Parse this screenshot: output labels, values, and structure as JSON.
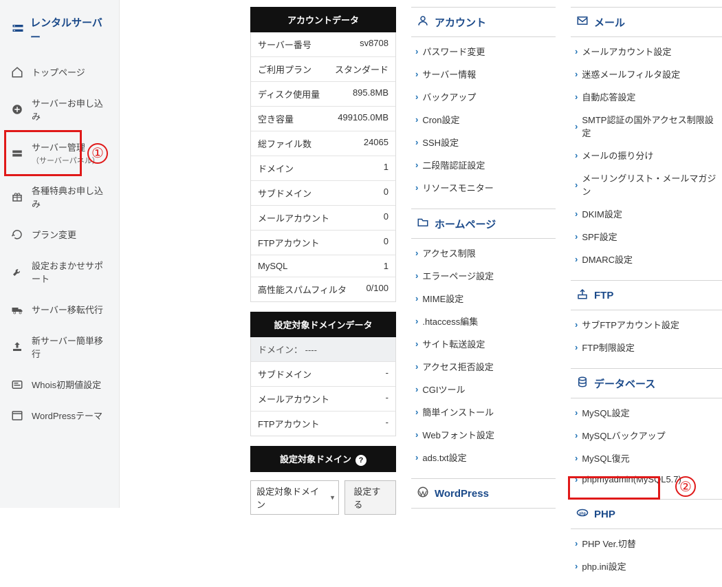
{
  "brand": "レンタルサーバー",
  "sidebar": [
    {
      "icon": "home",
      "label": "トップページ"
    },
    {
      "icon": "plus",
      "label": "サーバーお申し込み"
    },
    {
      "icon": "server",
      "label": "サーバー管理",
      "sub": "（サーバーパネル）",
      "highlight": true,
      "marker": "①"
    },
    {
      "icon": "gift",
      "label": "各種特典お申し込み"
    },
    {
      "icon": "refresh",
      "label": "プラン変更"
    },
    {
      "icon": "wrench",
      "label": "設定おまかせサポート"
    },
    {
      "icon": "truck",
      "label": "サーバー移転代行"
    },
    {
      "icon": "upload",
      "label": "新サーバー簡単移行"
    },
    {
      "icon": "card",
      "label": "Whois初期値設定"
    },
    {
      "icon": "window",
      "label": "WordPressテーマ"
    }
  ],
  "account_data": {
    "title": "アカウントデータ",
    "rows": [
      {
        "k": "サーバー番号",
        "v": "sv8708"
      },
      {
        "k": "ご利用プラン",
        "v": "スタンダード"
      },
      {
        "k": "ディスク使用量",
        "v": "895.8MB"
      },
      {
        "k": "空き容量",
        "v": "499105.0MB"
      },
      {
        "k": "総ファイル数",
        "v": "24065"
      },
      {
        "k": "ドメイン",
        "v": "1"
      },
      {
        "k": "サブドメイン",
        "v": "0"
      },
      {
        "k": "メールアカウント",
        "v": "0"
      },
      {
        "k": "FTPアカウント",
        "v": "0"
      },
      {
        "k": "MySQL",
        "v": "1"
      },
      {
        "k": "高性能スパムフィルタ",
        "v": "0/100"
      }
    ]
  },
  "domain_data": {
    "title": "設定対象ドメインデータ",
    "top": "ドメイン： ----",
    "rows": [
      {
        "k": "サブドメイン",
        "v": "-"
      },
      {
        "k": "メールアカウント",
        "v": "-"
      },
      {
        "k": "FTPアカウント",
        "v": "-"
      }
    ]
  },
  "domain_target": {
    "title": "設定対象ドメイン",
    "select": "設定対象ドメイン",
    "button": "設定する"
  },
  "cats_mid": [
    {
      "icon": "user",
      "title": "アカウント",
      "items": [
        "パスワード変更",
        "サーバー情報",
        "バックアップ",
        "Cron設定",
        "SSH設定",
        "二段階認証設定",
        "リソースモニター"
      ]
    },
    {
      "icon": "folder",
      "title": "ホームページ",
      "items": [
        "アクセス制限",
        "エラーページ設定",
        "MIME設定",
        ".htaccess編集",
        "サイト転送設定",
        "アクセス拒否設定",
        "CGIツール",
        "簡単インストール",
        "Webフォント設定",
        "ads.txt設定"
      ]
    },
    {
      "icon": "wp",
      "title": "WordPress",
      "items": []
    }
  ],
  "cats_right": [
    {
      "icon": "mail",
      "title": "メール",
      "items": [
        "メールアカウント設定",
        "迷惑メールフィルタ設定",
        "自動応答設定",
        "SMTP認証の国外アクセス制限設定",
        "メールの振り分け",
        "メーリングリスト・メールマガジン",
        "DKIM設定",
        "SPF設定",
        "DMARC設定"
      ]
    },
    {
      "icon": "ftp",
      "title": "FTP",
      "items": [
        "サブFTPアカウント設定",
        "FTP制限設定"
      ]
    },
    {
      "icon": "db",
      "title": "データベース",
      "items": [
        "MySQL設定",
        "MySQLバックアップ",
        "MySQL復元",
        "phpmyadmin(MySQL5.7)"
      ]
    },
    {
      "icon": "php",
      "title": "PHP",
      "items": [
        "PHP Ver.切替",
        "php.ini設定"
      ]
    }
  ],
  "marker2": "②"
}
